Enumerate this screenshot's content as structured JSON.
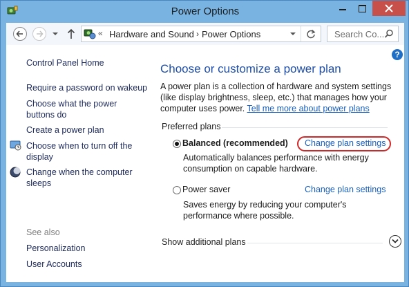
{
  "window": {
    "title": "Power Options",
    "icon": "power-options-icon",
    "buttons": [
      "minimize",
      "maximize",
      "close"
    ]
  },
  "navbar": {
    "breadcrumb_prefix": "«",
    "breadcrumbs": [
      "Hardware and Sound",
      "Power Options"
    ],
    "breadcrumb_separator": "›",
    "search_placeholder": "Search Co..."
  },
  "sidebar": {
    "home": "Control Panel Home",
    "links": [
      {
        "label_lines": [
          "Require a password on wakeup"
        ],
        "icon": ""
      },
      {
        "label_lines": [
          "Choose what the power",
          "buttons do"
        ],
        "icon": ""
      },
      {
        "label_lines": [
          "Create a power plan"
        ],
        "icon": ""
      },
      {
        "label_lines": [
          "Choose when to turn off the",
          "display"
        ],
        "icon": "display-icon"
      },
      {
        "label_lines": [
          "Change when the computer",
          "sleeps"
        ],
        "icon": "sleep-moon-icon"
      }
    ],
    "see_also_label": "See also",
    "see_also": [
      "Personalization",
      "User Accounts"
    ]
  },
  "main": {
    "heading": "Choose or customize a power plan",
    "description_lines": [
      "A power plan is a collection of hardware and system settings",
      "(like display brightness, sleep, etc.) that manages how your",
      "computer uses power."
    ],
    "tell_more_link": "Tell me more about power plans",
    "group_label": "Preferred plans",
    "plans": [
      {
        "name": "Balanced (recommended)",
        "selected": true,
        "description_lines": [
          "Automatically balances performance with energy",
          "consumption on capable hardware."
        ],
        "link": "Change plan settings"
      },
      {
        "name": "Power saver",
        "selected": false,
        "description_lines": [
          "Saves energy by reducing your computer's",
          "performance where possible."
        ],
        "link": "Change plan settings"
      }
    ],
    "show_more": "Show additional plans"
  },
  "colors": {
    "accent_link": "#1a5fbf",
    "heading": "#1f4ea8",
    "highlight_ring": "#cc2a2a",
    "close_button": "#c7504a",
    "frame": "#78b3e2"
  }
}
